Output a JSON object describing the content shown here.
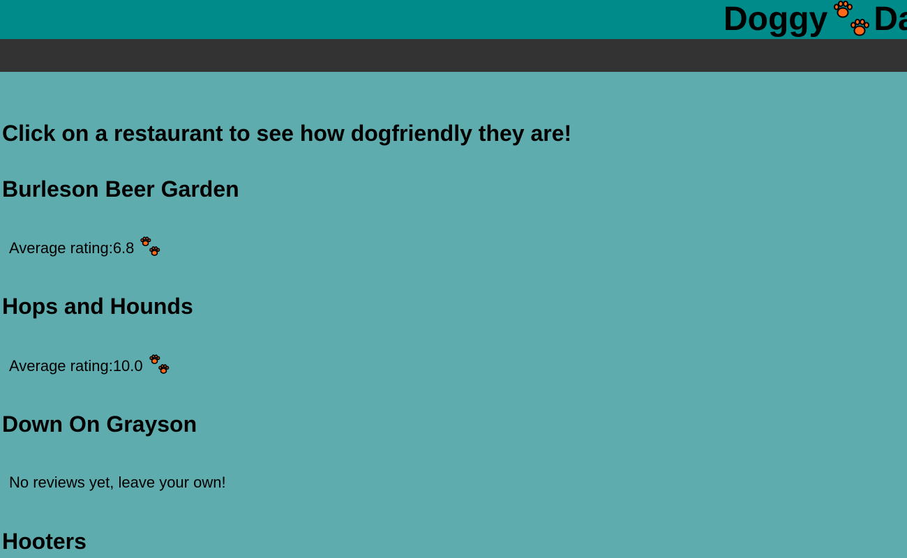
{
  "header": {
    "title_left": "Doggy",
    "title_right": "Da",
    "logo_icon": "paw-prints-icon"
  },
  "main": {
    "intro": "Click on a restaurant to see how dogfriendly they are!",
    "restaurants": [
      {
        "name": "Burleson Beer Garden",
        "status_prefix": "Average rating: ",
        "rating": "6.8",
        "icon": "paw-prints-icon"
      },
      {
        "name": "Hops and Hounds",
        "status_prefix": "Average rating: ",
        "rating": "10.0",
        "icon": "paw-prints-icon"
      },
      {
        "name": "Down On Grayson",
        "status_text": "No reviews yet, leave your own!"
      },
      {
        "name": "Hooters"
      }
    ]
  },
  "colors": {
    "header_bg": "#008b8b",
    "nav_bg": "#333333",
    "page_bg": "#5facaf",
    "paw_fill": "#ff6a1a"
  }
}
